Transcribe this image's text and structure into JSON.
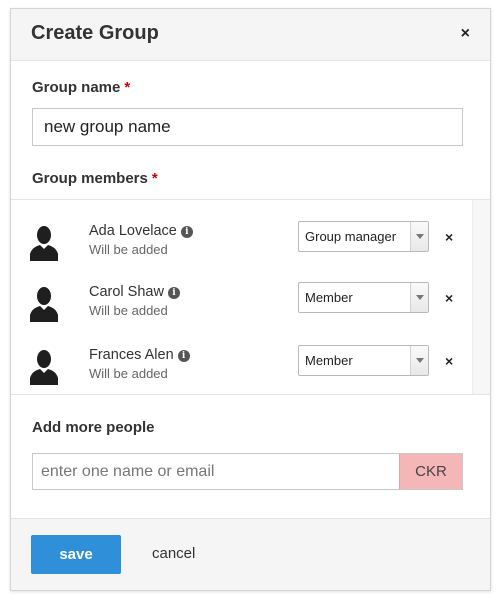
{
  "dialog": {
    "title": "Create Group",
    "close_icon": "close-icon",
    "close_label": "×"
  },
  "group_name": {
    "label": "Group name",
    "required_mark": "*",
    "value": "new group name"
  },
  "group_members": {
    "label": "Group members",
    "required_mark": "*",
    "info_glyph": "i",
    "remove_glyph": "×",
    "items": [
      {
        "name": "Ada Lovelace",
        "status": "Will be added",
        "role": "Group manager"
      },
      {
        "name": "Carol Shaw",
        "status": "Will be added",
        "role": "Member"
      },
      {
        "name": "Frances Alen",
        "status": "Will be added",
        "role": "Member"
      }
    ]
  },
  "add_people": {
    "label": "Add more people",
    "placeholder": "enter one name or email",
    "badge": "CKR"
  },
  "footer": {
    "save_label": "save",
    "cancel_label": "cancel"
  },
  "colors": {
    "primary": "#2f8fd8",
    "required": "#cc0000",
    "badge_bg": "#f5b6b8"
  }
}
